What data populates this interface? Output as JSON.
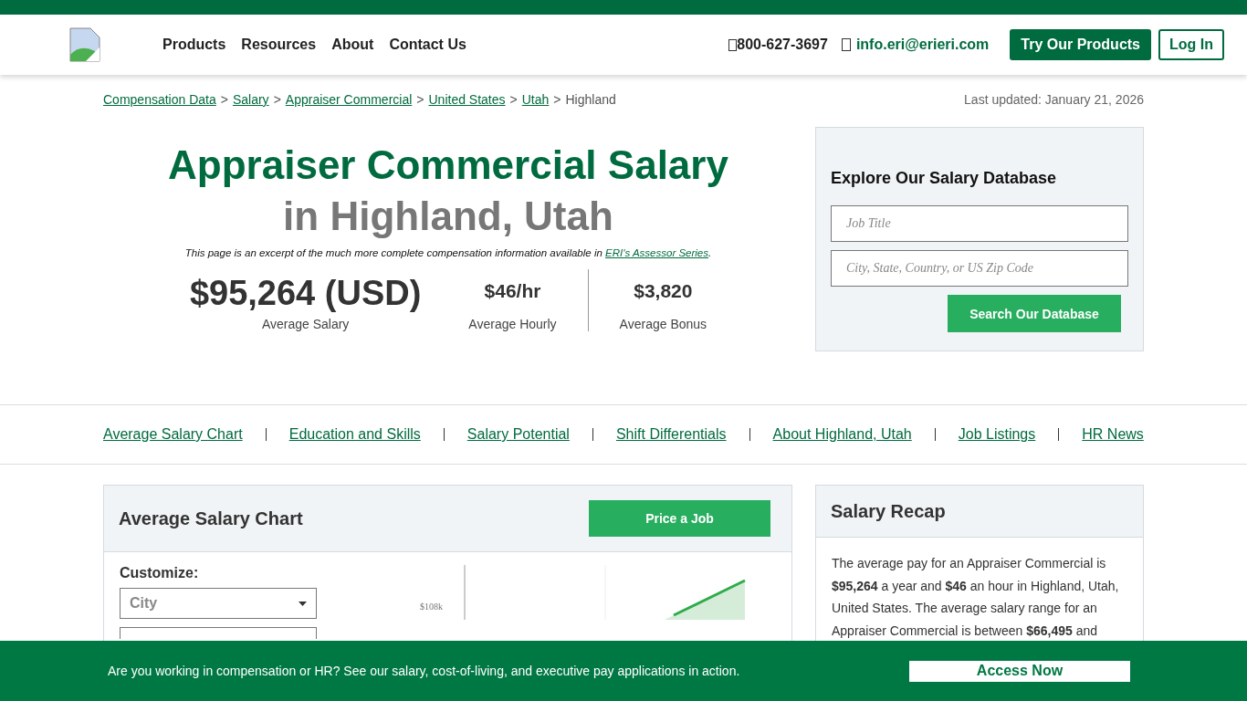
{
  "header": {
    "nav": [
      "Products",
      "Resources",
      "About",
      "Contact Us"
    ],
    "phone": "800-627-3697",
    "email": "info.eri@erieri.com",
    "buttons": [
      {
        "label": "Try Our Products",
        "kind": "primary"
      },
      {
        "label": "Log In",
        "kind": "outline"
      }
    ]
  },
  "breadcrumb": {
    "links": [
      "Compensation Data",
      "Salary",
      "Appraiser Commercial",
      "United States",
      "Utah"
    ],
    "current": "Highland",
    "separator": ">"
  },
  "last_updated": "Last updated: January 21, 2026",
  "hero": {
    "title": "Appraiser Commercial Salary",
    "subtitle": "in Highland, Utah",
    "note": "This page is an excerpt of the much more complete compensation information available in ",
    "note_link": "ERI's Assessor Series",
    "note_end": ".",
    "stats": [
      {
        "value": "$95,264 (USD)",
        "label": "Average Salary"
      },
      {
        "value": "$46/hr",
        "label": "Average Hourly"
      },
      {
        "value": "$3,820",
        "label": "Average Bonus"
      }
    ]
  },
  "search_panel": {
    "title": "Explore Our Salary Database",
    "fields": [
      {
        "placeholder": "Job Title"
      },
      {
        "placeholder": "City, State, Country, or US Zip Code"
      }
    ],
    "button": "Search Our Database"
  },
  "section_nav": [
    "Average Salary Chart",
    "Education and Skills",
    "Salary Potential",
    "Shift Differentials",
    "About Highland, Utah",
    "Job Listings",
    "HR News"
  ],
  "chart_card": {
    "title": "Average Salary Chart",
    "button": "Price a Job",
    "customize_label": "Customize:",
    "selects": [
      {
        "placeholder": "City",
        "kind": "dropdown"
      },
      {
        "kind": "covered"
      }
    ],
    "tick_label": "$108k"
  },
  "recap": {
    "title": "Salary Recap",
    "text": "The average pay for an Appraiser Commercial is **$95,264** a year and **$46** an hour in Highland, Utah, United States. The average salary range for an Appraiser Commercial is between **$66,495** and"
  },
  "banner": {
    "text": "Are you working in compensation or HR? See our salary, cost-of-living, and executive pay applications in action.",
    "button": "Access Now"
  }
}
